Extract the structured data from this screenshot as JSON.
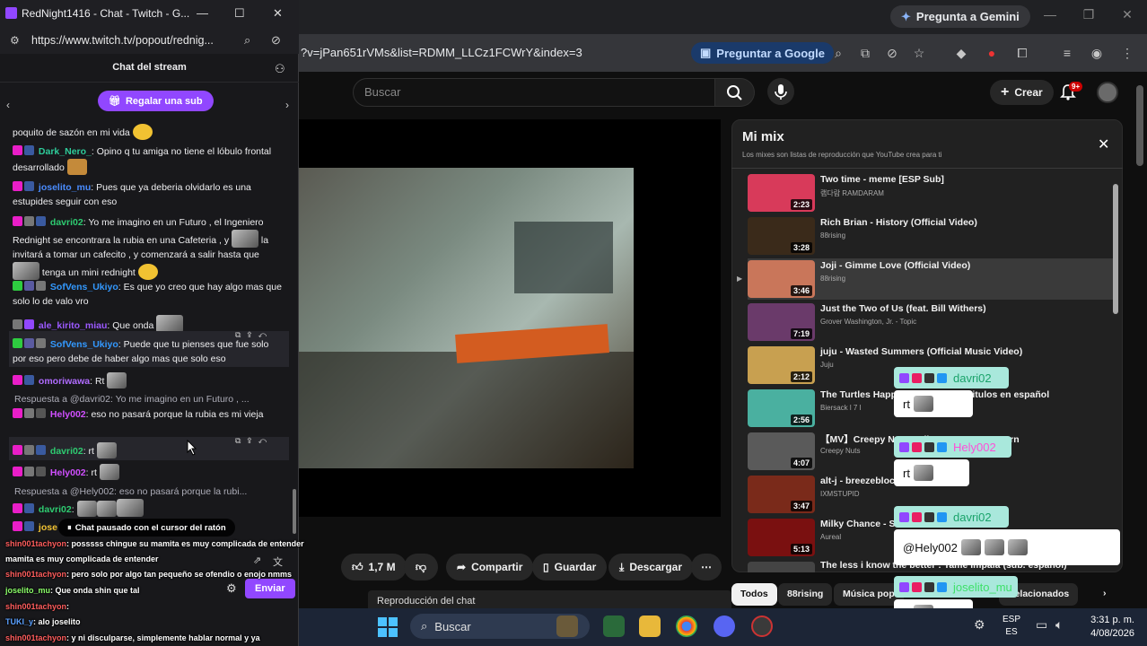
{
  "browser": {
    "gemini_label": "Pregunta a Gemini",
    "url_fragment": "?v=jPan651rVMs&list=RDMM_LLCz1FCWrY&index=3",
    "google_label": "Preguntar a Google"
  },
  "youtube": {
    "search_placeholder": "Buscar",
    "create_label": "Crear",
    "bell_badge": "9+",
    "likes": "1,7 M",
    "share": "Compartir",
    "save": "Guardar",
    "download": "Descargar",
    "chat_replay": "Reproducción del chat",
    "playlist": {
      "title": "Mi mix",
      "subtitle": "Los mixes son listas de reproducción que YouTube crea para ti",
      "items": [
        {
          "title": "Two time - meme [ESP Sub]",
          "channel": "램다람 RAMDARAM",
          "duration": "2:23",
          "color": "#d83a5a"
        },
        {
          "title": "Rich Brian - History (Official Video)",
          "channel": "88rising",
          "duration": "3:28",
          "color": "#3a2a1a"
        },
        {
          "title": "Joji - Gimme Love (Official Video)",
          "channel": "88rising",
          "duration": "3:46",
          "color": "#c9765a"
        },
        {
          "title": "Just the Two of Us (feat. Bill Withers)",
          "channel": "Grover Washington, Jr. - Topic",
          "duration": "7:19",
          "color": "#6a3a6a"
        },
        {
          "title": "juju - Wasted Summers (Official Music Video)",
          "channel": "Juju",
          "duration": "2:12",
          "color": "#c8a050"
        },
        {
          "title": "The Turtles Happy Together - subtitulos en español",
          "channel": "Biersack l 7 l",
          "duration": "2:56",
          "color": "#4ab0a0"
        },
        {
          "title": "【MV】Creepy Nuts - Bling-Bang-Bang-Born",
          "channel": "Creepy Nuts",
          "duration": "4:07",
          "color": "#5a5a5a"
        },
        {
          "title": "alt-j - breezeblocks",
          "channel": "IXMSTUPID",
          "duration": "3:47",
          "color": "#7a2a1a"
        },
        {
          "title": "Milky Chance - Stolen Dance",
          "channel": "Aureal",
          "duration": "5:13",
          "color": "#7a1010"
        },
        {
          "title": "The less i know the better : Tame Impala (sub. español)",
          "channel": "",
          "duration": "",
          "color": "#444"
        }
      ]
    },
    "chips": [
      "Todos",
      "88rising",
      "Música pop",
      "Relacionados"
    ]
  },
  "overlay_chat": [
    {
      "user": "davri02",
      "msg": "rt"
    },
    {
      "user": "Hely002",
      "msg": "rt"
    },
    {
      "user": "davri02",
      "msg": "@Hely002"
    },
    {
      "user": "joselito_mu",
      "msg": "rt"
    }
  ],
  "taskbar": {
    "search": "Buscar",
    "lang_top": "ESP",
    "lang_bottom": "ES",
    "time": "3:31 p. m.",
    "date": "4/08/2026"
  },
  "twitch": {
    "window_title": "RedNight1416 - Chat - Twitch - G...",
    "url": "https://www.twitch.tv/popout/rednig...",
    "header": "Chat del stream",
    "gift": "Regalar una sub",
    "paused": "Chat pausado con el cursor del ratón",
    "send": "Enviar",
    "messages": {
      "m0": "poquito de sazón en mi vida",
      "m1_user": "Dark_Nero_",
      "m1_text": ": Opino q tu amiga no tiene el lóbulo frontal desarrollado",
      "m2_user": "joselito_mu",
      "m2_text": ": Pues que ya deberia olvidarlo es una estupides seguir con eso",
      "m3_user": "davri02",
      "m3_text_a": ": Yo me imagino en un Futuro , el Ingeniero Rednight se encontrara la rubia en una Cafeteria , y",
      "m3_text_b": "la invitará a tomar un cafecito , y comenzará a salir hasta que",
      "m3_text_c": "tenga un mini rednight",
      "m4_user": "SofVens_Ukiyo",
      "m4_text": ": Es que yo creo que hay algo mas que solo lo de valo vro",
      "m5_user": "ale_kirito_miau",
      "m5_text": ": Que onda",
      "m6_user": "SofVens_Ukiyo",
      "m6_text": ": Puede que tu pienses que fue solo por eso pero debe de haber algo mas que solo eso",
      "m7_user": "omoriwawa",
      "m7_text": ": Rt",
      "r1": "Respuesta a @davri02: Yo me imagino en un Futuro , ...",
      "m8_user": "Hely002",
      "m8_text": ": eso no pasará porque la rubia es mi vieja",
      "m9_user": "davri02",
      "m9_text": ": rt",
      "m10_user": "Hely002",
      "m10_text": ": rt",
      "r2": "Respuesta a @Hely002: eso no pasará porque la rubi...",
      "m11_user": "davri02",
      "m11_text": ":",
      "m12_user": "jose"
    }
  },
  "overlay_mini": [
    {
      "user": "shin001tachyon",
      "text": ": posssss chingue su mamita es muy complicada de entender"
    },
    {
      "user": "",
      "text": "mamita es muy complicada de entender"
    },
    {
      "user": "shin001tachyon",
      "text": ": pero solo por algo tan pequeño se ofendio o enojo nmms"
    },
    {
      "user": "joselito_mu",
      "text": ": Que onda shin que tal"
    },
    {
      "user": "shin001tachyon",
      "text": ":"
    },
    {
      "user": "TUKI_y",
      "text": ": alo joselito"
    },
    {
      "user": "shin001tachyon",
      "text": ": y ni disculparse, simplemente hablar normal y ya"
    }
  ]
}
